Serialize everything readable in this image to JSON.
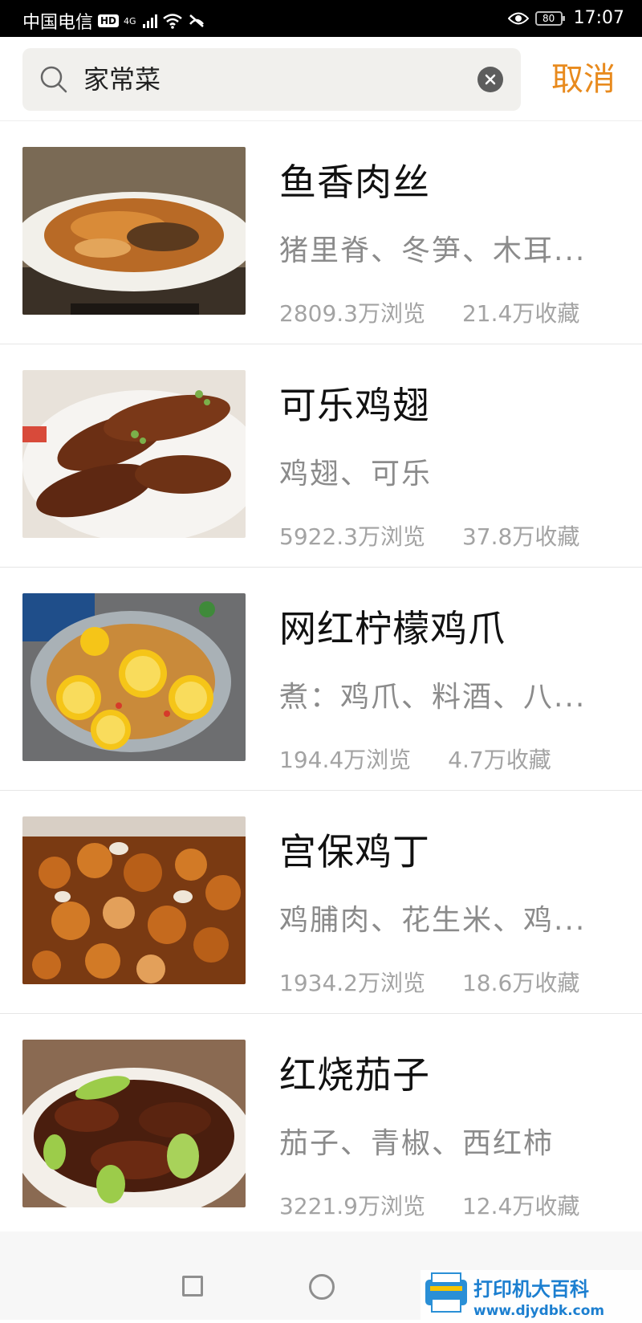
{
  "status_bar": {
    "carrier": "中国电信",
    "hd": "HD",
    "network": "4G",
    "battery": "80",
    "time": "17:07"
  },
  "search": {
    "query": "家常菜",
    "cancel_label": "取消"
  },
  "recipes": [
    {
      "title": "鱼香肉丝",
      "ingredients": "猪里脊、冬笋、木耳...",
      "views": "2809.3万浏览",
      "favorites": "21.4万收藏"
    },
    {
      "title": "可乐鸡翅",
      "ingredients": "鸡翅、可乐",
      "views": "5922.3万浏览",
      "favorites": "37.8万收藏"
    },
    {
      "title": "网红柠檬鸡爪",
      "ingredients": "煮：鸡爪、料酒、八...",
      "views": "194.4万浏览",
      "favorites": "4.7万收藏"
    },
    {
      "title": "宫保鸡丁",
      "ingredients": "鸡脯肉、花生米、鸡...",
      "views": "1934.2万浏览",
      "favorites": "18.6万收藏"
    },
    {
      "title": "红烧茄子",
      "ingredients": "茄子、青椒、西红柿",
      "views": "3221.9万浏览",
      "favorites": "12.4万收藏"
    }
  ],
  "watermark": {
    "title": "打印机大百科",
    "url": "www.djydbk.com"
  },
  "colors": {
    "accent": "#e88a1d",
    "search_bg": "#f1f0ed",
    "title": "#111111",
    "muted": "#8b8b8b",
    "stats": "#a3a3a3"
  }
}
